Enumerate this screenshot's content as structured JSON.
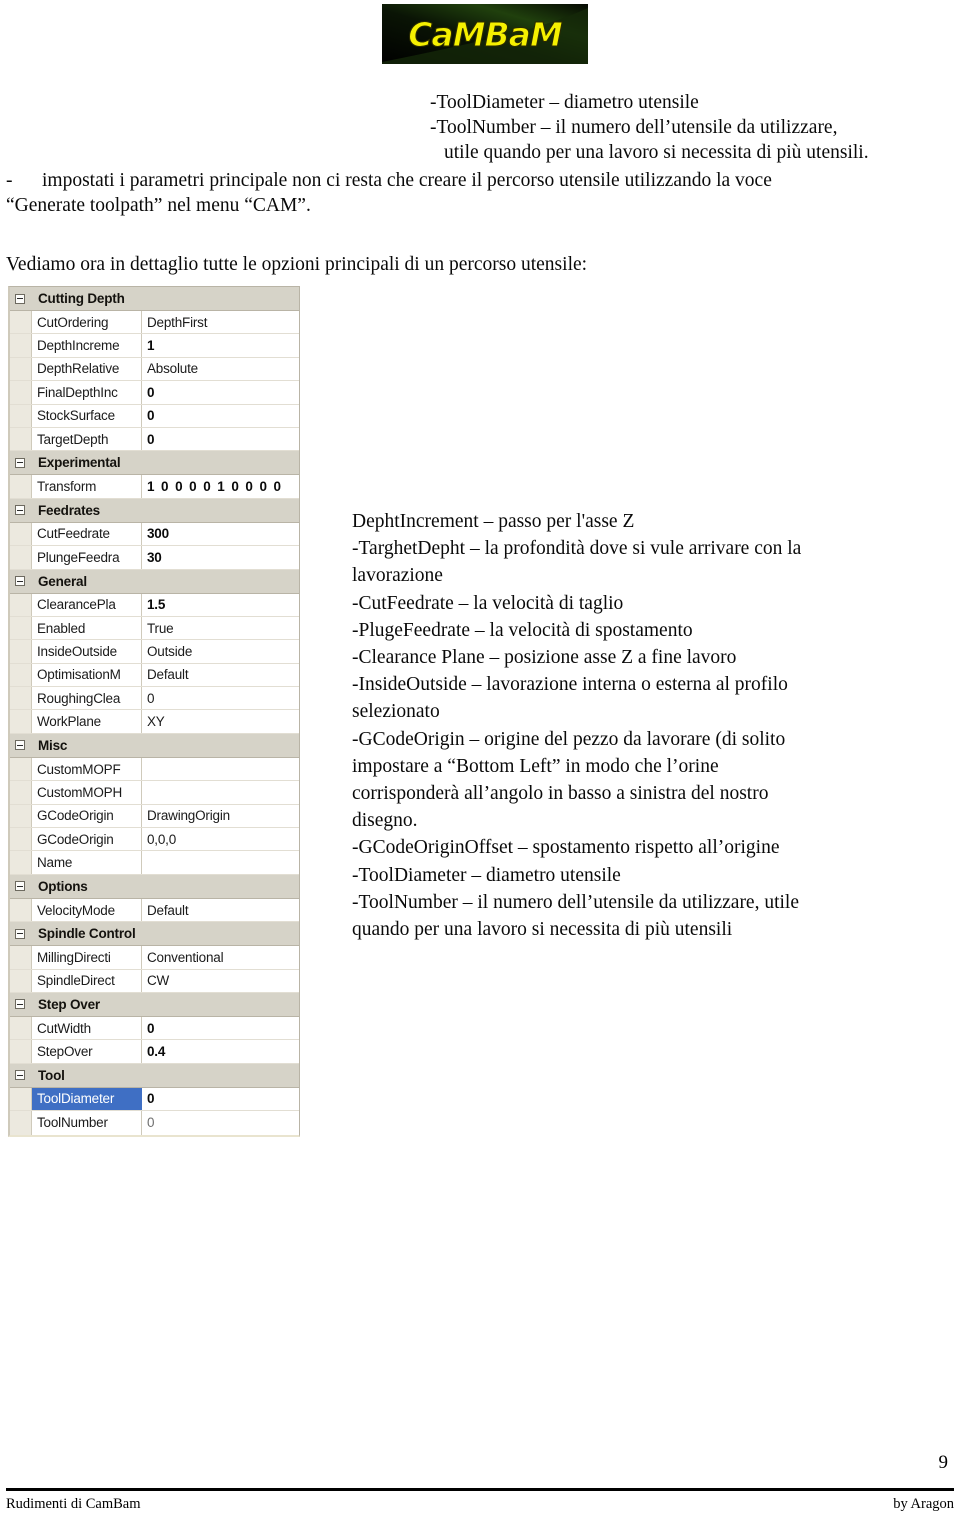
{
  "logo": {
    "alt_text": "CamBam",
    "wordmark": "CaMBaM",
    "background_color": "#0b0f05",
    "text_color": "#f5f000"
  },
  "intro": {
    "tool_lines": [
      "-ToolDiameter – diametro utensile",
      "-ToolNumber – il numero dell’utensile da utilizzare,",
      "utile quando per una lavoro si necessita di più utensili."
    ],
    "bullet_dash": "-",
    "bullet_text": "impostati i parametri principale non ci resta che creare il percorso utensile utilizzando la voce",
    "bullet_text_line2": "“Generate toolpath” nel menu “CAM”.",
    "section_intro": "Vediamo ora in dettaglio tutte le opzioni principali di un percorso utensile:"
  },
  "explanations": [
    "DephtIncrement – passo per l'asse Z",
    "-TarghetDepht – la profondità dove si vule arrivare con la",
    "lavorazione",
    "-CutFeedrate – la velocità di taglio",
    "-PlugeFeedrate – la velocità di spostamento",
    "-Clearance Plane – posizione asse Z a fine lavoro",
    "-InsideOutside – lavorazione interna o esterna al profilo",
    "selezionato",
    "-GCodeOrigin – origine del pezzo da lavorare (di solito",
    "impostare a “Bottom Left” in modo che l’orine",
    "corrisponderà all’angolo in basso a sinistra del nostro",
    "disegno.",
    "-GCodeOriginOffset – spostamento rispetto all’origine",
    "-ToolDiameter – diametro utensile",
    "-ToolNumber – il numero dell’utensile da utilizzare, utile",
    "quando per una lavoro si necessita di più utensili"
  ],
  "property_grid": {
    "selection_color": "#3f6fc4",
    "category_color": "#d6d3c8",
    "rows": [
      {
        "kind": "category",
        "label": "Cutting Depth"
      },
      {
        "kind": "prop",
        "name": "CutOrdering",
        "value": "DepthFirst",
        "bold": false
      },
      {
        "kind": "prop",
        "name": "DepthIncreme",
        "value": "1",
        "bold": true
      },
      {
        "kind": "prop",
        "name": "DepthRelative",
        "value": "Absolute",
        "bold": false
      },
      {
        "kind": "prop",
        "name": "FinalDepthInc",
        "value": "0",
        "bold": true
      },
      {
        "kind": "prop",
        "name": "StockSurface",
        "value": "0",
        "bold": true
      },
      {
        "kind": "prop",
        "name": "TargetDepth",
        "value": "0",
        "bold": true
      },
      {
        "kind": "category",
        "label": "Experimental"
      },
      {
        "kind": "prop",
        "name": "Transform",
        "value": "1 0 0 0 0 1 0 0 0 0",
        "bold": true,
        "wide": true
      },
      {
        "kind": "category",
        "label": "Feedrates"
      },
      {
        "kind": "prop",
        "name": "CutFeedrate",
        "value": "300",
        "bold": true
      },
      {
        "kind": "prop",
        "name": "PlungeFeedra",
        "value": "30",
        "bold": true
      },
      {
        "kind": "category",
        "label": "General"
      },
      {
        "kind": "prop",
        "name": "ClearancePla",
        "value": "1.5",
        "bold": true
      },
      {
        "kind": "prop",
        "name": "Enabled",
        "value": "True",
        "bold": false
      },
      {
        "kind": "prop",
        "name": "InsideOutside",
        "value": "Outside",
        "bold": false
      },
      {
        "kind": "prop",
        "name": "OptimisationM",
        "value": "Default",
        "bold": false
      },
      {
        "kind": "prop",
        "name": "RoughingClea",
        "value": "0",
        "bold": false
      },
      {
        "kind": "prop",
        "name": "WorkPlane",
        "value": "XY",
        "bold": false
      },
      {
        "kind": "category",
        "label": "Misc"
      },
      {
        "kind": "prop",
        "name": "CustomMOPF",
        "value": "",
        "bold": false
      },
      {
        "kind": "prop",
        "name": "CustomMOPH",
        "value": "",
        "bold": false
      },
      {
        "kind": "prop",
        "name": "GCodeOrigin",
        "value": "DrawingOrigin",
        "bold": false
      },
      {
        "kind": "prop",
        "name": "GCodeOrigin",
        "value": "0,0,0",
        "bold": false
      },
      {
        "kind": "prop",
        "name": "Name",
        "value": "",
        "bold": false
      },
      {
        "kind": "category",
        "label": "Options"
      },
      {
        "kind": "prop",
        "name": "VelocityMode",
        "value": "Default",
        "bold": false
      },
      {
        "kind": "category",
        "label": "Spindle Control"
      },
      {
        "kind": "prop",
        "name": "MillingDirecti",
        "value": "Conventional",
        "bold": false
      },
      {
        "kind": "prop",
        "name": "SpindleDirect",
        "value": "CW",
        "bold": false
      },
      {
        "kind": "category",
        "label": "Step Over"
      },
      {
        "kind": "prop",
        "name": "CutWidth",
        "value": "0",
        "bold": true
      },
      {
        "kind": "prop",
        "name": "StepOver",
        "value": "0.4",
        "bold": true
      },
      {
        "kind": "category",
        "label": "Tool"
      },
      {
        "kind": "prop",
        "name": "ToolDiameter",
        "value": "0",
        "bold": true,
        "selected": true
      },
      {
        "kind": "prop",
        "name": "ToolNumber",
        "value": "0",
        "bold": false,
        "muted": true
      }
    ]
  },
  "footer": {
    "page_number": "9",
    "left_text": "Rudimenti di CamBam",
    "right_text": "by Aragon"
  }
}
